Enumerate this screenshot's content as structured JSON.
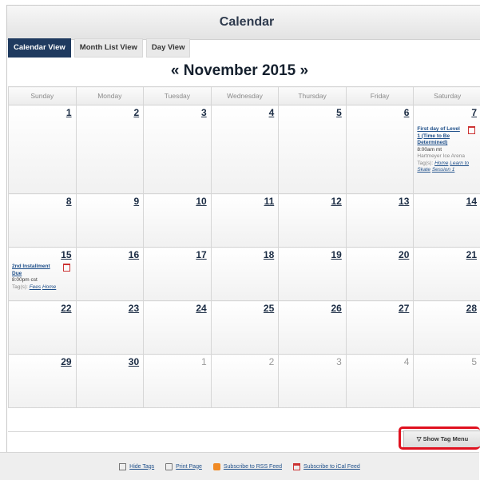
{
  "header": {
    "title": "Calendar"
  },
  "view_tabs": [
    "Calendar View",
    "Month List View",
    "Day View"
  ],
  "month": {
    "prev": "«",
    "label": "November 2015",
    "next": "»"
  },
  "weekdays": [
    "Sunday",
    "Monday",
    "Tuesday",
    "Wednesday",
    "Thursday",
    "Friday",
    "Saturday"
  ],
  "weeks": [
    [
      "1",
      "2",
      "3",
      "4",
      "5",
      "6",
      "7"
    ],
    [
      "8",
      "9",
      "10",
      "11",
      "12",
      "13",
      "14"
    ],
    [
      "15",
      "16",
      "17",
      "18",
      "19",
      "20",
      "21"
    ],
    [
      "22",
      "23",
      "24",
      "25",
      "26",
      "27",
      "28"
    ],
    [
      "29",
      "30",
      "1",
      "2",
      "3",
      "4",
      "5"
    ]
  ],
  "events": {
    "e7": {
      "title": "First day of Level 1 (Time to Be Determined)",
      "time": "8:00am mt",
      "location": "Hartmeyer Ice Arena",
      "tags_label": "Tag(s):",
      "tags": [
        "Home",
        "Learn to Skate",
        "Session 1"
      ]
    },
    "e15": {
      "title": "2nd Installment Due",
      "time": "8:00pm cst",
      "tags_label": "Tag(s):",
      "tags": [
        "Fees",
        "Home"
      ]
    }
  },
  "tag_menu": {
    "label": "▽ Show Tag Menu"
  },
  "footer": {
    "hide_tags": "Hide Tags",
    "print_page": "Print Page",
    "rss": "Subscribe to RSS Feed",
    "ical": "Subscribe to iCal Feed"
  }
}
